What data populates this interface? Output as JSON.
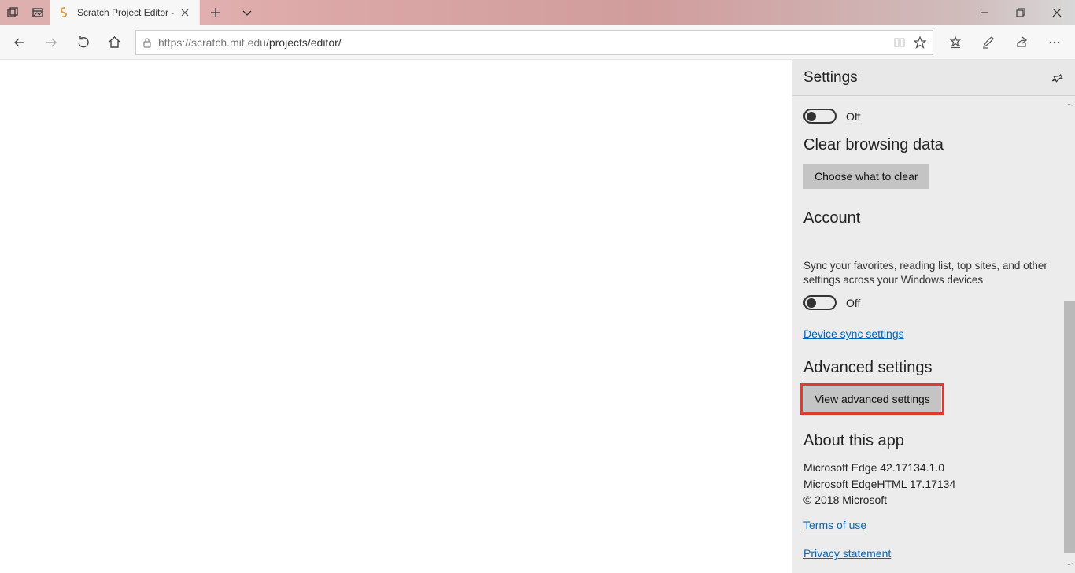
{
  "tab": {
    "title": "Scratch Project Editor -"
  },
  "address": {
    "scheme_host": "https://scratch.mit.edu",
    "path": "/projects/editor/"
  },
  "settings": {
    "title": "Settings",
    "toggle1_label": "Off",
    "clear_heading": "Clear browsing data",
    "clear_button": "Choose what to clear",
    "account_heading": "Account",
    "sync_desc": "Sync your favorites, reading list, top sites, and other settings across your Windows devices",
    "toggle2_label": "Off",
    "sync_link": "Device sync settings",
    "advanced_heading": "Advanced settings",
    "advanced_button": "View advanced settings",
    "about_heading": "About this app",
    "about_line1": "Microsoft Edge 42.17134.1.0",
    "about_line2": "Microsoft EdgeHTML 17.17134",
    "about_line3": "© 2018 Microsoft",
    "terms_link": "Terms of use",
    "privacy_link": "Privacy statement"
  }
}
